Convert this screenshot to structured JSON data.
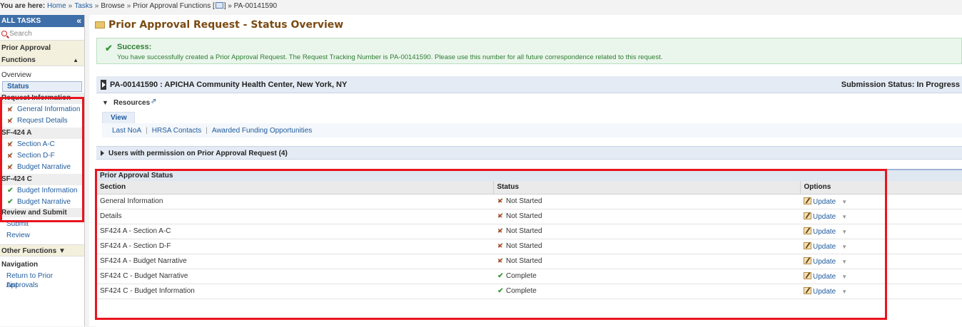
{
  "breadcrumb": {
    "label": "You are here:",
    "items": [
      "Home",
      "Tasks",
      "Browse",
      "Prior Approval Functions [",
      "] » PA-00141590"
    ]
  },
  "sidebar": {
    "header": "ALL TASKS",
    "collapse_glyph": "«",
    "search_placeholder": "Search",
    "group_title_1": "Prior Approval",
    "group_title_2": "Functions",
    "overview": "Overview",
    "status": "Status",
    "sections": [
      {
        "title": "Request Information",
        "items": [
          {
            "label": "General Information",
            "icon": "x-check-icon"
          },
          {
            "label": "Request Details",
            "icon": "x-check-icon"
          }
        ]
      },
      {
        "title": "SF-424 A",
        "items": [
          {
            "label": "Section A-C",
            "icon": "x-check-icon"
          },
          {
            "label": "Section D-F",
            "icon": "x-check-icon"
          },
          {
            "label": "Budget Narrative",
            "icon": "x-check-icon"
          }
        ]
      },
      {
        "title": "SF-424 C",
        "items": [
          {
            "label": "Budget Information",
            "icon": "check-icon"
          },
          {
            "label": "Budget Narrative",
            "icon": "check-icon"
          }
        ]
      }
    ],
    "review_submit": "Review and Submit",
    "submit": "Submit",
    "review": "Review",
    "other_functions": "Other Functions",
    "navigation": "Navigation",
    "return_link_1": "Return to Prior Approvals",
    "return_link_2": "List"
  },
  "main": {
    "title": "Prior Approval Request - Status Overview",
    "success": {
      "title": "Success:",
      "message": "You have successfully created a Prior Approval Request. The Request Tracking Number is PA-00141590. Please use this number for all future correspondence related to this request."
    },
    "header": {
      "title": "PA-00141590 : APICHA Community Health Center, New York, NY",
      "submission_status": "Submission Status: In Progress"
    },
    "resources": {
      "title": "Resources",
      "view_tab": "View",
      "links": [
        "Last NoA",
        "HRSA Contacts",
        "Awarded Funding Opportunities"
      ]
    },
    "users_panel": "Users with permission on Prior Approval Request (4)",
    "status_panel": {
      "title": "Prior Approval Status",
      "columns": [
        "Section",
        "Status",
        "Options"
      ],
      "rows": [
        {
          "section": "General Information",
          "status": "Not Started",
          "option": "Update"
        },
        {
          "section": "Details",
          "status": "Not Started",
          "option": "Update"
        },
        {
          "section": "SF424 A - Section A-C",
          "status": "Not Started",
          "option": "Update"
        },
        {
          "section": "SF424 A - Section D-F",
          "status": "Not Started",
          "option": "Update"
        },
        {
          "section": "SF424 A - Budget Narrative",
          "status": "Not Started",
          "option": "Update"
        },
        {
          "section": "SF424 C - Budget Narrative",
          "status": "Complete",
          "option": "Update"
        },
        {
          "section": "SF424 C - Budget Information",
          "status": "Complete",
          "option": "Update"
        }
      ]
    }
  },
  "colors": {
    "sidebar_header": "#3f6fa9",
    "highlight_box": "#e8141e",
    "success_text": "#2e7d32",
    "link": "#1f5b9c",
    "title": "#7a4a12"
  }
}
